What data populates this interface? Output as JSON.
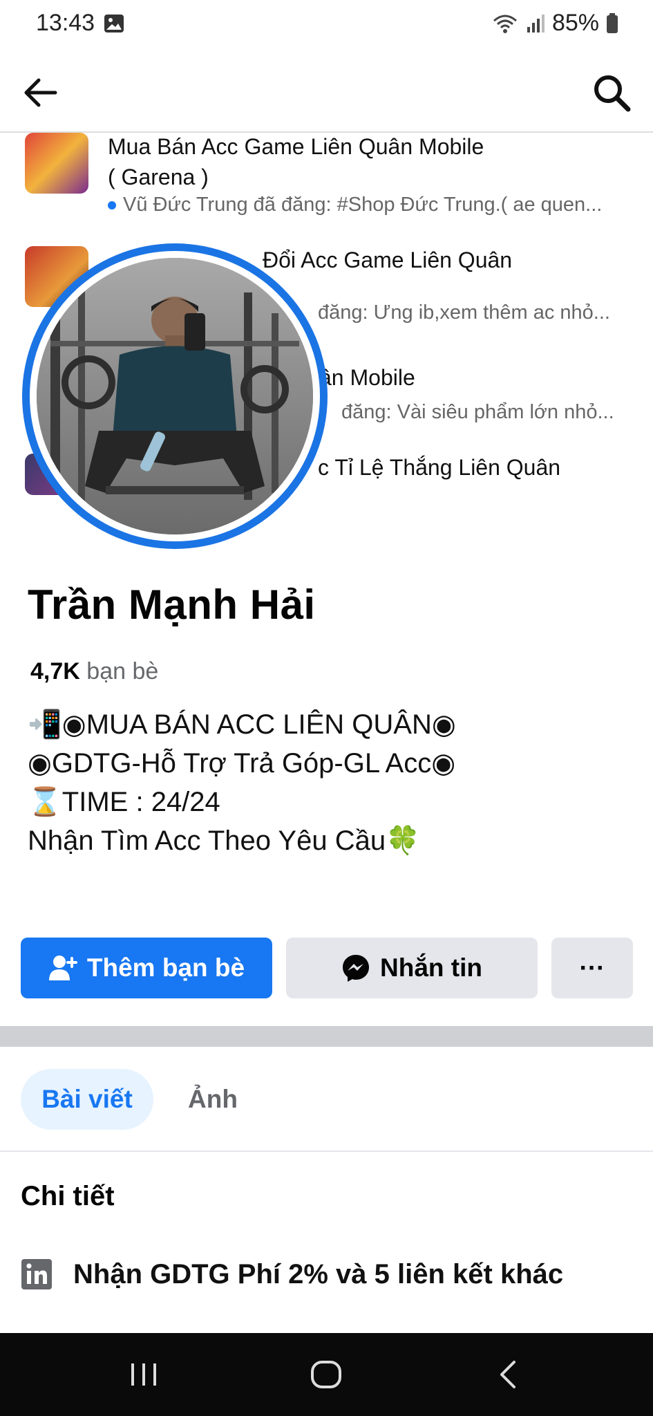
{
  "status_bar": {
    "time": "13:43",
    "battery": "85%"
  },
  "groups": [
    {
      "title_line1": "Mua Bán Acc Game Liên Quân Mobile",
      "title_line2": "( Garena )",
      "subtitle": "Vũ Đức Trung đã đăng: #Shop Đức Trung.( ae quen..."
    },
    {
      "title_line1": "Đổi Acc Game Liên Quân",
      "subtitle": "đăng: Ưng ib,xem thêm ac nhỏ..."
    },
    {
      "title_line1": "ân Mobile",
      "subtitle": "đăng: Vài siêu phẩm lớn nhỏ..."
    },
    {
      "title_line1": "c Tỉ Lệ Thắng Liên Quân"
    }
  ],
  "profile": {
    "name": "Trần Mạnh Hải",
    "friends_count": "4,7K",
    "friends_label": "bạn bè",
    "bio": [
      "📲◉MUA BÁN ACC LIÊN QUÂN◉",
      "◉GDTG-Hỗ Trợ Trả Góp-GL Acc◉",
      "⌛TIME : 24/24",
      "Nhận Tìm Acc Theo Yêu Cầu🍀"
    ]
  },
  "actions": {
    "add_friend": "Thêm bạn bè",
    "message": "Nhắn tin",
    "more": "···"
  },
  "tabs": {
    "posts": "Bài viết",
    "photos": "Ảnh"
  },
  "details": {
    "title": "Chi tiết",
    "link_text": "Nhận GDTG Phí 2% và 5 liên kết khác"
  },
  "colors": {
    "primary": "#1877f2",
    "button_gray": "#e4e6eb",
    "tab_active_bg": "#e7f3ff"
  }
}
